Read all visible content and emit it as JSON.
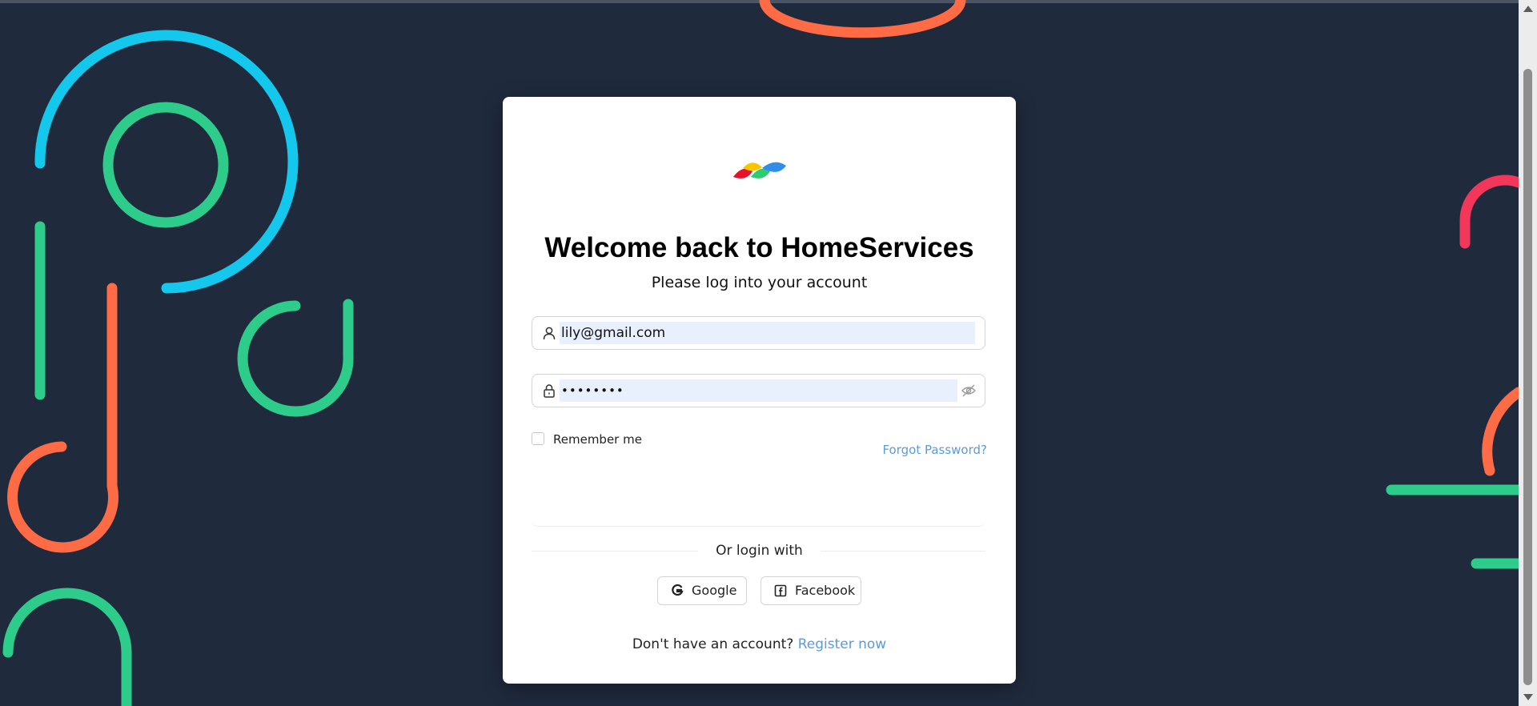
{
  "app": {
    "title": "Welcome back to HomeServices",
    "subtitle": "Please log into your account"
  },
  "login_form": {
    "email": {
      "value": "lily@gmail.com",
      "icon": "user-icon"
    },
    "password": {
      "value": "••••••••",
      "icon": "lock-icon",
      "toggle_icon": "eye-slash-icon"
    },
    "remember_label": "Remember me",
    "remember_checked": false,
    "forgot_label": "Forgot Password?"
  },
  "social": {
    "divider_text": "Or login with",
    "google_label": "Google",
    "facebook_label": "Facebook"
  },
  "footer": {
    "prompt": "Don't have an account?",
    "register_label": "Register now"
  },
  "colors": {
    "background": "#1f2a3d",
    "card": "#ffffff",
    "link": "#5b9bd9",
    "autofill": "#e8f0fe",
    "deco_cyan": "#13c8ec",
    "deco_green": "#2ecc8a",
    "deco_orange": "#ff6b45",
    "deco_pink": "#f2375a"
  }
}
